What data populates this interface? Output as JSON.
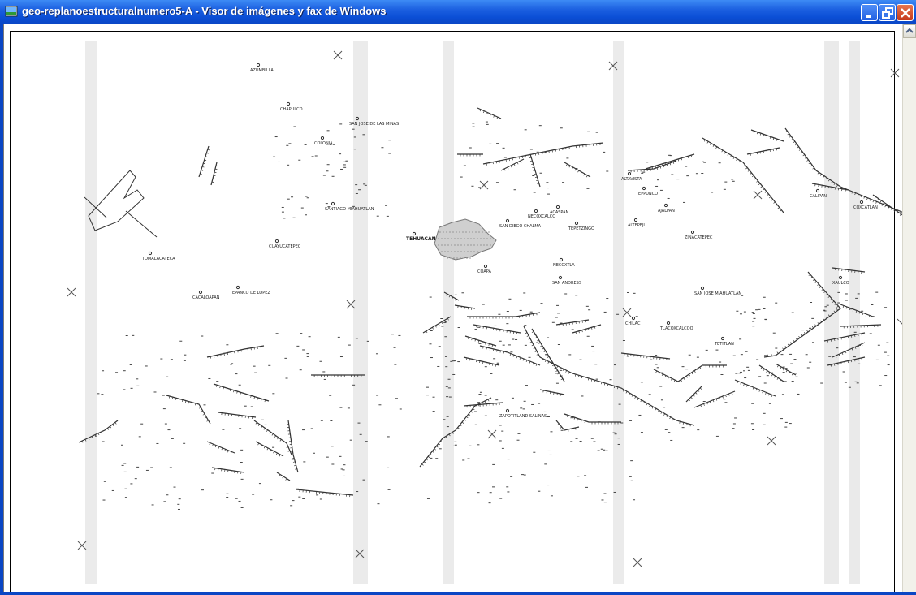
{
  "window": {
    "title": "geo-replanoestructuralnumero5-A - Visor de imágenes y fax de Windows",
    "controls": {
      "minimize": "minimize",
      "restore": "restore",
      "close": "close"
    }
  },
  "map": {
    "places": [
      "AZUMBILLA",
      "CHAPULCO",
      "SAN JOSE DE LAS MINAS",
      "COLONIA",
      "SANTIAGO MIAHUATLAN",
      "CUAYUCATEPEC",
      "TEHUACAN",
      "SAN DIEGO CHALMA",
      "NECOXCALCO",
      "ACASPAN",
      "TEPETZINGO",
      "ALTEPEJI",
      "ALTAVISTA",
      "TEPPUNCO",
      "AJALPAN",
      "ZINACATEPEC",
      "CALIPAN",
      "COXCATLAN",
      "TOMALACATECA",
      "CACALOAPAN",
      "TEPANCO DE LOPEZ",
      "NECOXTLA",
      "COAPA",
      "SAN ANDRESS",
      "SAN JOSE MIAHUATLAN",
      "XAULCO",
      "CHILAC",
      "TLACOXCALCOO",
      "TETITLAN",
      "ZAPOTITLAND SALINAS"
    ]
  }
}
